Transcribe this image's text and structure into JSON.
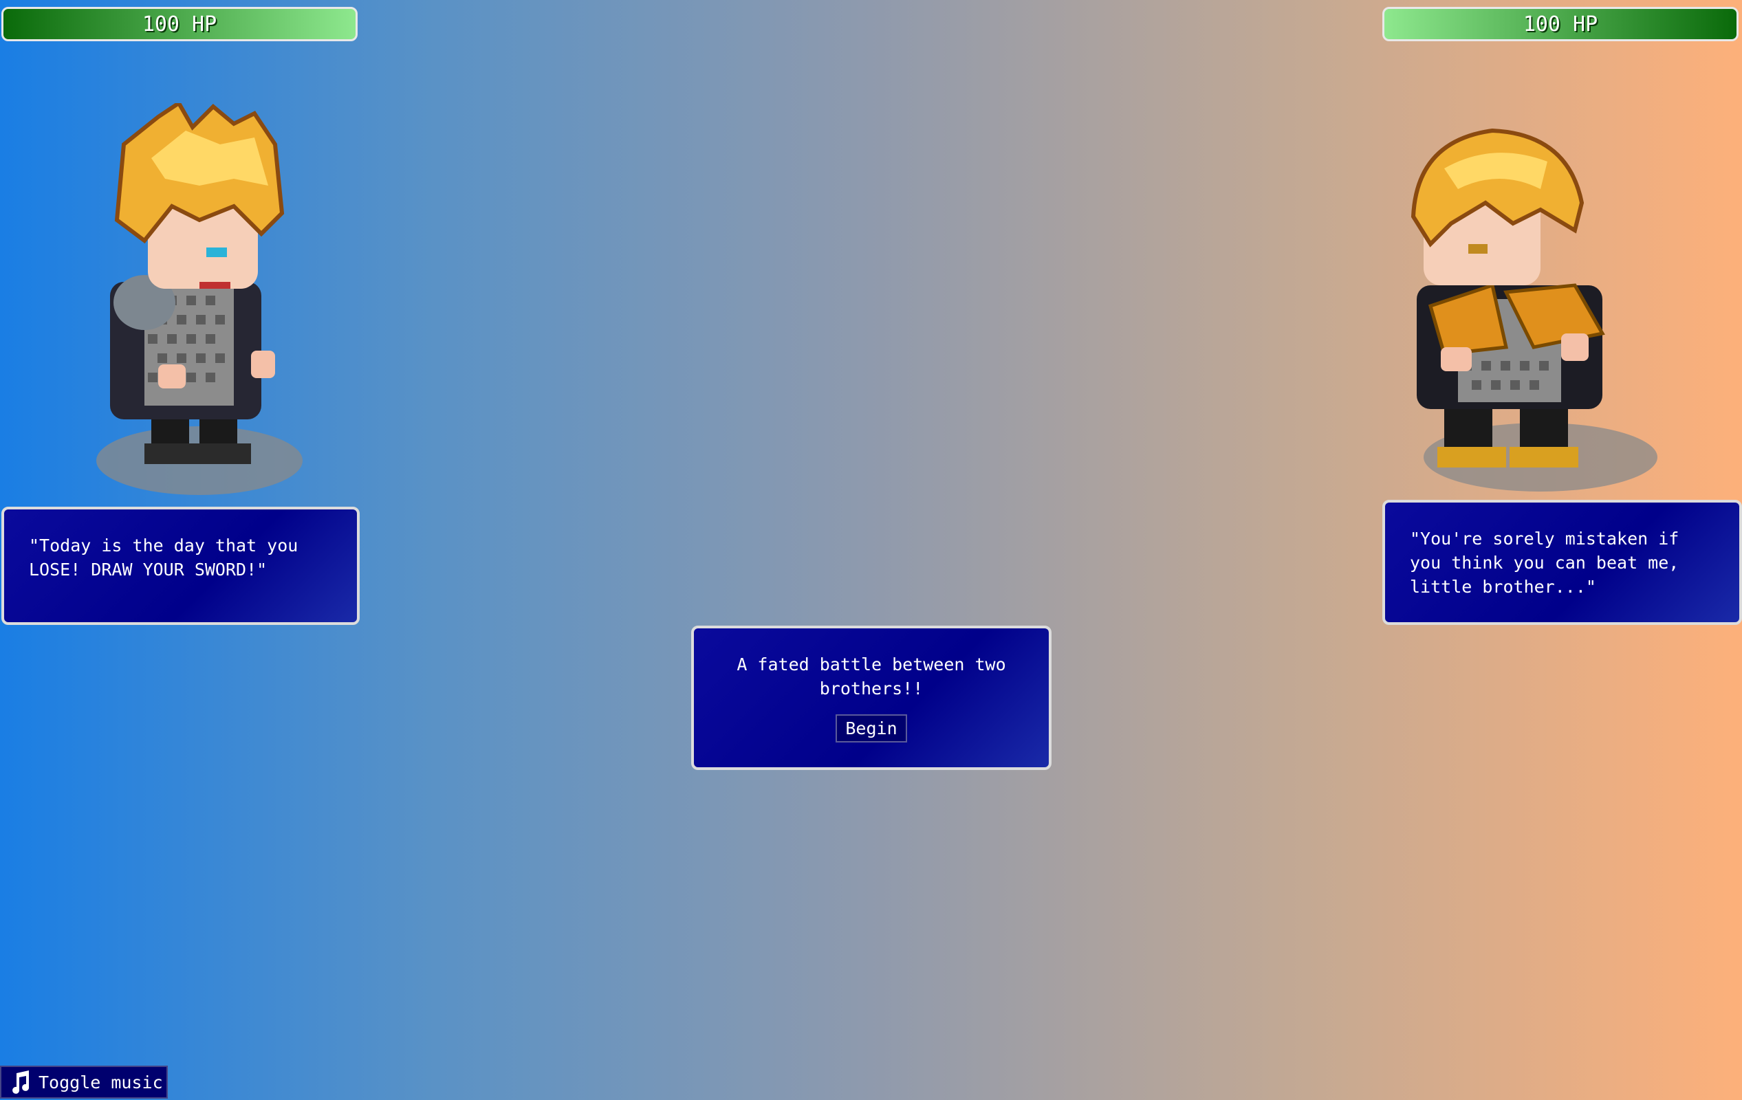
{
  "player_left": {
    "hp_label": "100 HP",
    "speech": "\"Today is the day that you LOSE! DRAW YOUR SWORD!\""
  },
  "player_right": {
    "hp_label": "100 HP",
    "speech": "\"You're sorely mistaken if you think you can beat me, little brother...\""
  },
  "intro": {
    "message": "A fated battle between two brothers!!",
    "begin_label": "Begin"
  },
  "music": {
    "label": "Toggle music",
    "icon": "music-note-icon"
  },
  "colors": {
    "hp_dark": "#0a6a0a",
    "hp_light": "#8ee88e",
    "dialog_bg": "#00008a",
    "bg_left": "#1a7ee4",
    "bg_right": "#fdb07a"
  }
}
